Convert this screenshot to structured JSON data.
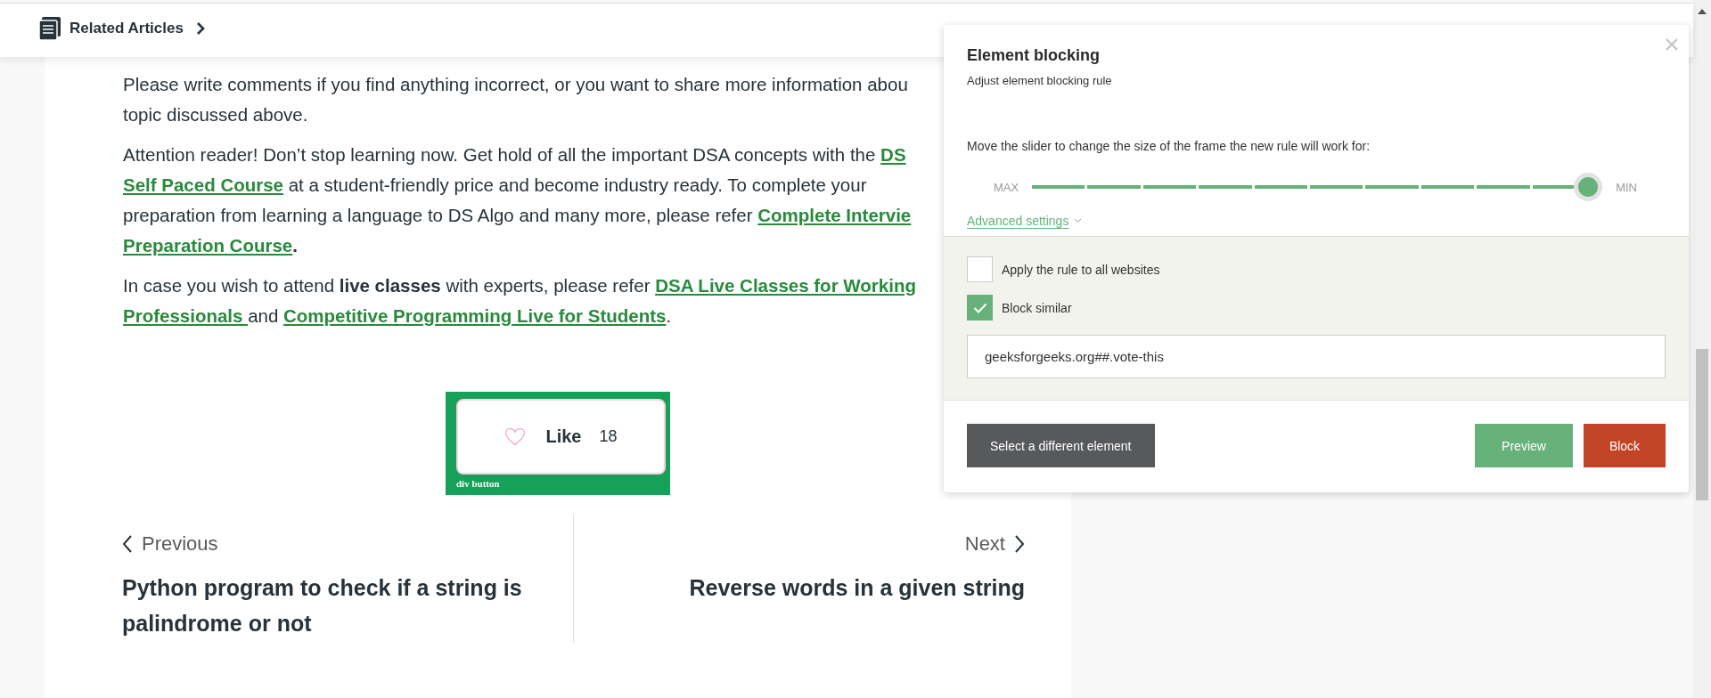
{
  "header": {
    "title": "Related Articles"
  },
  "article": {
    "paragraphs": [
      {
        "lines": [
          [
            {
              "kind": "text",
              "text": "Please write comments if you find anything incorrect, or you want to share more information abou"
            }
          ],
          [
            {
              "kind": "text",
              "text": "topic discussed above."
            }
          ]
        ]
      },
      {
        "lines": [
          [
            {
              "kind": "text",
              "text": "Attention reader! Don’t stop learning now. Get hold of all the important DSA concepts with the "
            },
            {
              "kind": "link",
              "text": "DS"
            }
          ],
          [
            {
              "kind": "link",
              "text": "Self Paced Course"
            },
            {
              "kind": "text",
              "text": " at a student-friendly price and become industry ready.  To complete your"
            }
          ],
          [
            {
              "kind": "text",
              "text": "preparation from learning a language to DS Algo and many more,  please refer "
            },
            {
              "kind": "link",
              "text": "Complete Intervie"
            }
          ],
          [
            {
              "kind": "link",
              "text": "Preparation Course"
            },
            {
              "kind": "bold",
              "text": "."
            }
          ]
        ]
      },
      {
        "lines": [
          [
            {
              "kind": "text",
              "text": "In case you wish to attend "
            },
            {
              "kind": "bold",
              "text": "live classes"
            },
            {
              "kind": "text",
              "text": " with experts, please refer "
            },
            {
              "kind": "link",
              "text": "DSA Live Classes for Working"
            }
          ],
          [
            {
              "kind": "link",
              "text": "Professionals "
            },
            {
              "kind": "text",
              "text": "and "
            },
            {
              "kind": "link",
              "text": "Competitive Programming Live for Students"
            },
            {
              "kind": "text",
              "text": "."
            }
          ]
        ]
      }
    ]
  },
  "like": {
    "label": "Like",
    "count": "18",
    "tag": "div button"
  },
  "post_nav": {
    "previous": {
      "label": "Previous",
      "title": "Python program to check if a string is palindrome or not"
    },
    "next": {
      "label": "Next",
      "title": "Reverse words in a given string"
    }
  },
  "dialog": {
    "title": "Element blocking",
    "subtitle": "Adjust element blocking rule",
    "slider_hint": "Move the slider to change the size of the frame the new rule will work for:",
    "slider": {
      "min_label": "MAX",
      "max_label": "MIN",
      "level": 1
    },
    "advanced": "Advanced settings",
    "options": [
      {
        "label": "Apply the rule to all websites",
        "checked": false
      },
      {
        "label": "Block similar",
        "checked": true
      }
    ],
    "rule": {
      "value": "geeksforgeeks.org##.vote-this"
    },
    "buttons": [
      {
        "label": "Select a different element",
        "kind": "secondary"
      },
      {
        "label": "Preview",
        "kind": "preview"
      },
      {
        "label": "Block",
        "kind": "danger"
      }
    ]
  }
}
